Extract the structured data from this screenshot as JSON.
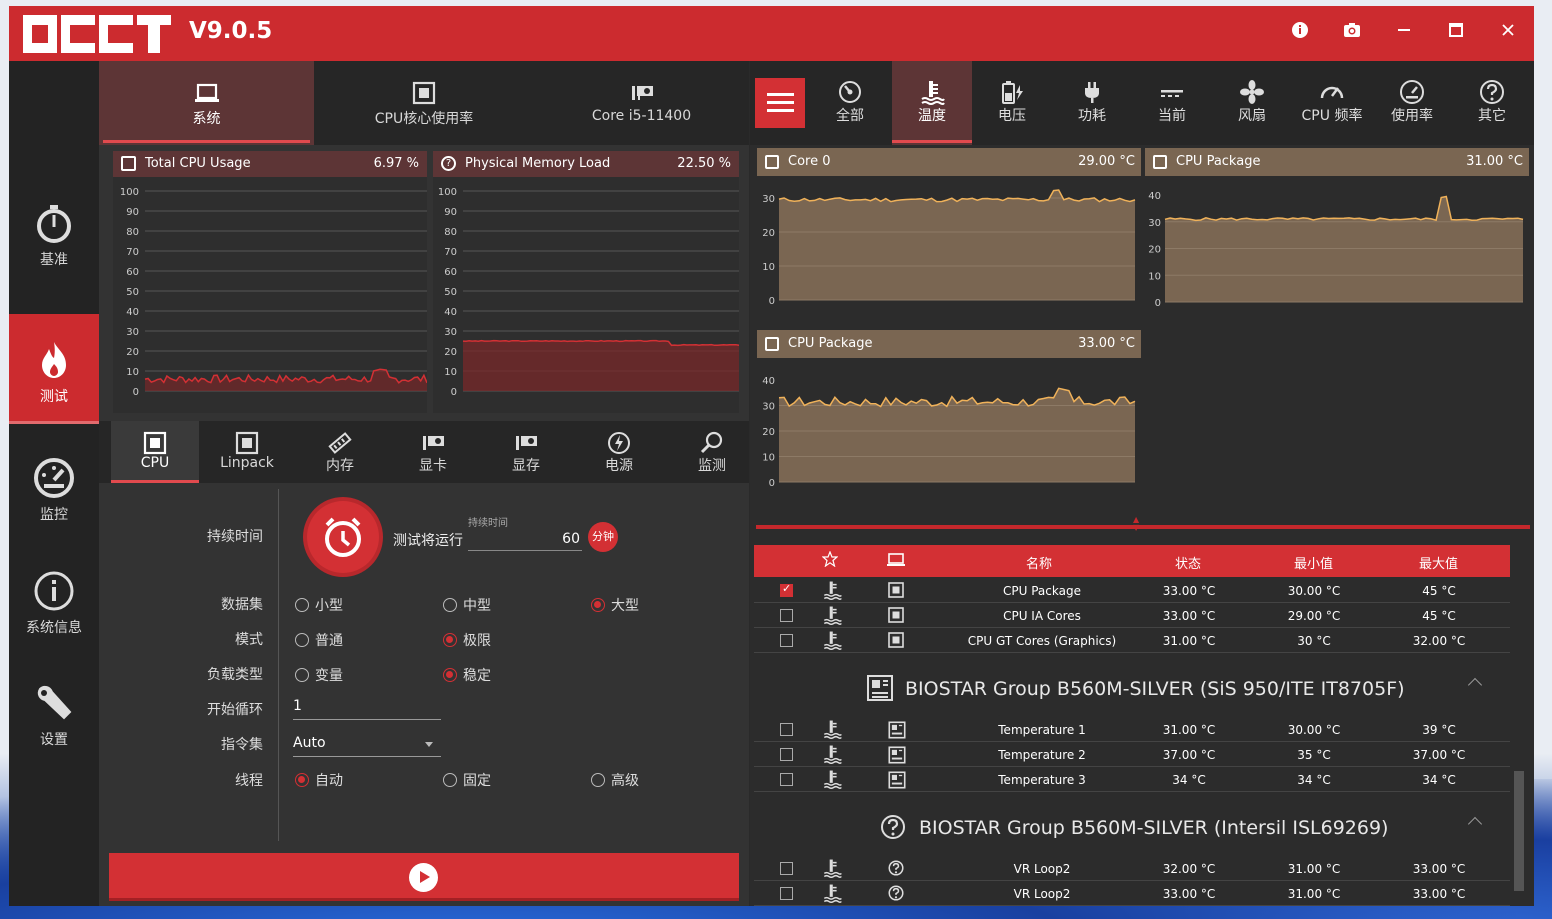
{
  "app": {
    "version": "V9.0.5",
    "accent": "#cc2b2f"
  },
  "titlebar": {
    "icons": [
      "info-icon",
      "camera-icon",
      "minimize-icon",
      "maximize-icon",
      "close-icon"
    ]
  },
  "sidebar": {
    "items": [
      {
        "label": "基准",
        "icon": "stopwatch-icon"
      },
      {
        "label": "测试",
        "icon": "flame-icon",
        "active": true
      },
      {
        "label": "监控",
        "icon": "gauge-icon"
      },
      {
        "label": "系统信息",
        "icon": "info-icon"
      },
      {
        "label": "设置",
        "icon": "wrench-icon"
      }
    ]
  },
  "top_tabs": [
    {
      "label": "系统",
      "icon": "laptop-icon",
      "active": true
    },
    {
      "label": "CPU核心使用率",
      "icon": "cpu-icon"
    },
    {
      "label": "Core i5-11400",
      "icon": "gpu-card-icon"
    }
  ],
  "graphs": [
    {
      "title": "Total CPU Usage",
      "value": "6.97 %",
      "ticks": [
        "100",
        "90",
        "80",
        "70",
        "60",
        "50",
        "40",
        "30",
        "20",
        "10",
        "0"
      ]
    },
    {
      "title": "Physical Memory Load",
      "value": "22.50 %",
      "ticks": [
        "100",
        "90",
        "80",
        "70",
        "60",
        "50",
        "40",
        "30",
        "20",
        "10",
        "0"
      ]
    }
  ],
  "test_tabs": [
    {
      "label": "CPU",
      "icon": "cpu-icon",
      "active": true
    },
    {
      "label": "Linpack",
      "icon": "cpu-icon"
    },
    {
      "label": "内存",
      "icon": "memory-icon"
    },
    {
      "label": "显卡",
      "icon": "gpu-card-icon"
    },
    {
      "label": "显存",
      "icon": "gpu-card-icon"
    },
    {
      "label": "电源",
      "icon": "power-icon"
    },
    {
      "label": "监测",
      "icon": "search-icon"
    }
  ],
  "form": {
    "duration_label": "持续时间",
    "run_label": "测试将运行",
    "duration_small": "持续时间",
    "duration_value": "60",
    "duration_unit": "分钟",
    "dataset_label": "数据集",
    "dataset_options": [
      "小型",
      "中型",
      "大型"
    ],
    "mode_label": "模式",
    "mode_options": [
      "普通",
      "极限"
    ],
    "load_label": "负载类型",
    "load_options": [
      "变量",
      "稳定"
    ],
    "loop_label": "开始循环",
    "loop_value": "1",
    "isa_label": "指令集",
    "isa_value": "Auto",
    "threads_label": "线程",
    "threads_options": [
      "自动",
      "固定",
      "高级"
    ]
  },
  "right_tabs": [
    {
      "label": "全部",
      "icon": "all-icon"
    },
    {
      "label": "温度",
      "icon": "thermometer-icon",
      "active": true
    },
    {
      "label": "电压",
      "icon": "battery-bolt-icon"
    },
    {
      "label": "功耗",
      "icon": "plug-icon"
    },
    {
      "label": "当前",
      "icon": "current-icon"
    },
    {
      "label": "风扇",
      "icon": "fan-icon"
    },
    {
      "label": "CPU 频率",
      "icon": "speedometer-icon"
    },
    {
      "label": "使用率",
      "icon": "gauge-icon"
    },
    {
      "label": "其它",
      "icon": "question-icon"
    }
  ],
  "temp_graphs": [
    {
      "title": "Core 0",
      "value": "29.00 °C",
      "ticks": [
        "30",
        "20",
        "10",
        "0"
      ]
    },
    {
      "title": "CPU Package",
      "value": "31.00 °C",
      "ticks": [
        "40",
        "30",
        "20",
        "10",
        "0"
      ]
    },
    {
      "title": "CPU Package",
      "value": "33.00 °C",
      "ticks": [
        "40",
        "30",
        "20",
        "10",
        "0"
      ]
    }
  ],
  "sensor_table": {
    "headers": [
      "名称",
      "状态",
      "最小值",
      "最大值"
    ],
    "group1_rows": [
      {
        "name": "CPU Package",
        "status": "33.00 °C",
        "min": "30.00 °C",
        "max": "45 °C",
        "checked": true
      },
      {
        "name": "CPU IA Cores",
        "status": "33.00 °C",
        "min": "29.00 °C",
        "max": "45 °C"
      },
      {
        "name": "CPU GT Cores (Graphics)",
        "status": "31.00 °C",
        "min": "30 °C",
        "max": "32.00 °C"
      }
    ],
    "group2_title": "BIOSTAR Group B560M-SILVER (SiS 950/ITE IT8705F)",
    "group2_rows": [
      {
        "name": "Temperature 1",
        "status": "31.00 °C",
        "min": "30.00 °C",
        "max": "39 °C"
      },
      {
        "name": "Temperature 2",
        "status": "37.00 °C",
        "min": "35 °C",
        "max": "37.00 °C"
      },
      {
        "name": "Temperature 3",
        "status": "34 °C",
        "min": "34 °C",
        "max": "34 °C"
      }
    ],
    "group3_title": "BIOSTAR Group B560M-SILVER (Intersil ISL69269)",
    "group3_rows": [
      {
        "name": "VR Loop2",
        "status": "32.00 °C",
        "min": "31.00 °C",
        "max": "33.00 °C"
      },
      {
        "name": "VR Loop2",
        "status": "33.00 °C",
        "min": "31.00 °C",
        "max": "33.00 °C"
      }
    ]
  }
}
